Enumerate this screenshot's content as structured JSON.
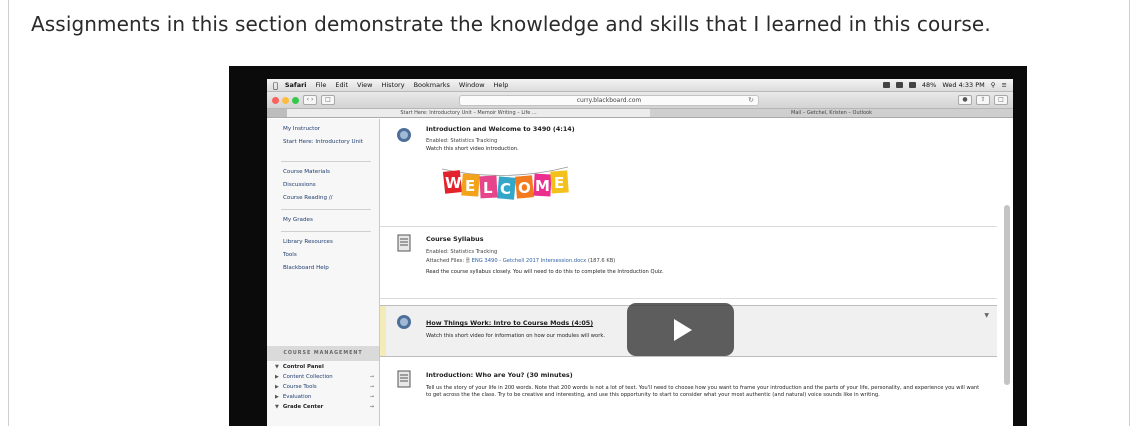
{
  "intro": {
    "text": "Assignments in this section demonstrate the knowledge and skills that I learned in this course."
  },
  "mac_menu": {
    "app": "Safari",
    "items": [
      "File",
      "Edit",
      "View",
      "History",
      "Bookmarks",
      "Window",
      "Help"
    ],
    "battery": "48%",
    "clock": "Wed 4:33 PM"
  },
  "safari": {
    "address": "curry.blackboard.com",
    "tabs": [
      "Start Here: Introductory Unit – Memoir Writing – Life ...",
      "Mail – Getchel, Kristen – Outlook"
    ]
  },
  "sidebar": {
    "group1": [
      "My Instructor",
      "Start Here: Introductory Unit"
    ],
    "group2": [
      "Course Materials",
      "Discussions",
      "Course Reading //"
    ],
    "group3": [
      "My Grades"
    ],
    "group4": [
      "Library Resources",
      "Tools",
      "Blackboard Help"
    ],
    "course_management_label": "COURSE MANAGEMENT",
    "cm_items": [
      "Control Panel",
      "Content Collection",
      "Course Tools",
      "Evaluation",
      "Grade Center"
    ]
  },
  "content": {
    "items": [
      {
        "title": "Introduction and Welcome to 3490 (4:14)",
        "meta": "Enabled:  Statistics Tracking",
        "desc": "Watch this short video introduction."
      },
      {
        "title": "Course Syllabus",
        "meta": "Enabled:  Statistics Tracking",
        "attached_label": "Attached Files:",
        "attached_file": "ENG 3490 - Getchell 2017 Intersession.docx",
        "attached_size": "(187.6 KB)",
        "desc": "Read the course syllabus closely.  You will need to do this to complete the Introduction Quiz."
      },
      {
        "title": "How Things Work: Intro to Course Mods (4:05)",
        "desc": "Watch this short video for information on how our modules will work."
      },
      {
        "title": "Introduction: Who are You? (30 minutes)",
        "desc": "Tell us the story of your life in 200 words.  Note that 200 words is not a lot of text.  You'll need to choose how you want to frame your introduction and the parts of your life, personality, and experience you will want to get across the the class.  Try to be creative and interesting, and  use this opportunity to start to consider what your most authentic (and natural) voice sounds like in writing."
      }
    ],
    "welcome_letters": [
      "W",
      "E",
      "L",
      "C",
      "O",
      "M",
      "E"
    ]
  },
  "colors": {
    "accent_link": "#2f62a8",
    "player_bg": "#0b0b0b"
  }
}
